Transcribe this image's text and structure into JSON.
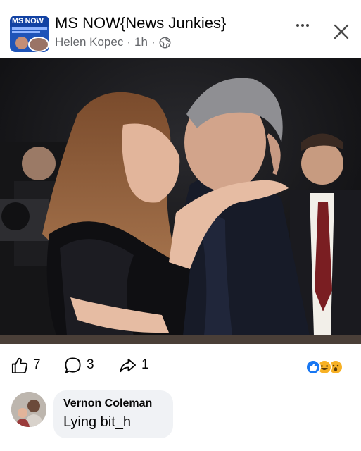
{
  "post": {
    "group_name": "MS NOW{News Junkies}",
    "author": "Helen Kopec",
    "time": "1h",
    "separator": "·",
    "privacy_icon": "globe-icon",
    "group_avatar_text": "MS NOW"
  },
  "header_actions": {
    "more_icon": "more-horizontal-icon",
    "close_icon": "close-icon"
  },
  "engagement": {
    "likes": "7",
    "comments": "3",
    "shares": "1",
    "reactions": [
      "like",
      "haha",
      "wow"
    ]
  },
  "comment": {
    "name": "Vernon Coleman",
    "text": "Lying bit_h"
  },
  "colors": {
    "text_primary": "#050505",
    "text_secondary": "#65676b",
    "like_blue": "#1877f2",
    "reaction_yellow": "#f7b125",
    "bubble_bg": "#f0f2f5"
  }
}
